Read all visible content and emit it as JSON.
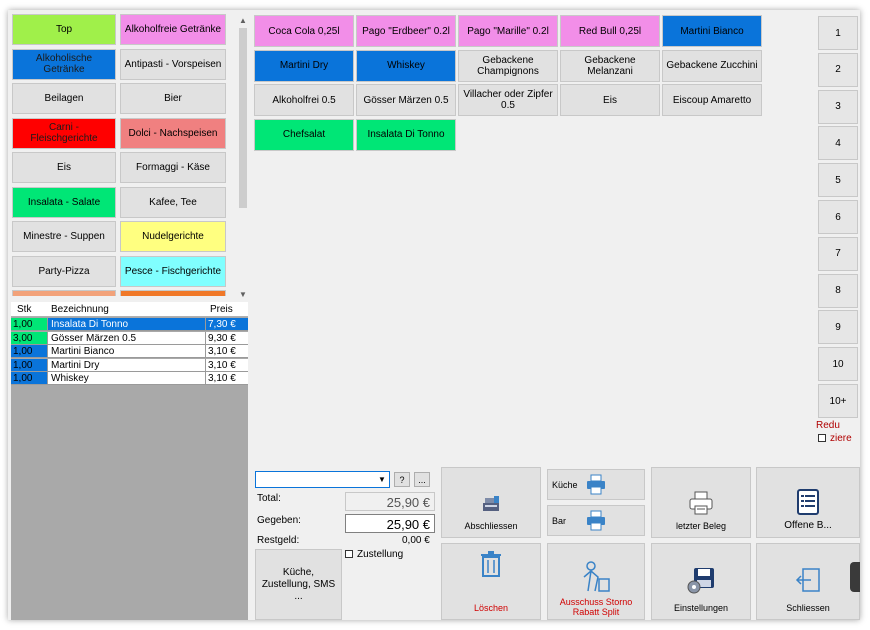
{
  "categories": [
    {
      "label": "Top",
      "color": "#a0f04a"
    },
    {
      "label": "Alkoholfreie Getränke",
      "color": "#f28ee8"
    },
    {
      "label": "Alkoholische Getränke",
      "color": "#0a74da"
    },
    {
      "label": "Antipasti - Vorspeisen",
      "color": "#e1e1e1"
    },
    {
      "label": "Beilagen",
      "color": "#e1e1e1"
    },
    {
      "label": "Bier",
      "color": "#e1e1e1"
    },
    {
      "label": "Carni - Fleischgerichte",
      "color": "#ff0000"
    },
    {
      "label": "Dolci - Nachspeisen",
      "color": "#f08080"
    },
    {
      "label": "Eis",
      "color": "#e1e1e1"
    },
    {
      "label": "Formaggi - Käse",
      "color": "#e1e1e1"
    },
    {
      "label": "Insalata - Salate",
      "color": "#00e676"
    },
    {
      "label": "Kafee, Tee",
      "color": "#e1e1e1"
    },
    {
      "label": "Minestre - Suppen",
      "color": "#e1e1e1"
    },
    {
      "label": "Nudelgerichte",
      "color": "#ffff80"
    },
    {
      "label": "Party-Pizza",
      "color": "#e1e1e1"
    },
    {
      "label": "Pesce - Fischgerichte",
      "color": "#80ffff"
    }
  ],
  "products": [
    {
      "label": "Coca Cola 0,25l",
      "color": "#f28ee8"
    },
    {
      "label": "Pago \"Erdbeer\" 0.2l",
      "color": "#f28ee8"
    },
    {
      "label": "Pago \"Marille\" 0.2l",
      "color": "#f28ee8"
    },
    {
      "label": "Red Bull 0,25l",
      "color": "#f28ee8"
    },
    {
      "label": "Martini Bianco",
      "color": "#0a74da"
    },
    {
      "label": "Martini Dry",
      "color": "#0a74da"
    },
    {
      "label": "Whiskey",
      "color": "#0a74da"
    },
    {
      "label": "Gebackene Champignons",
      "color": "#e1e1e1"
    },
    {
      "label": "Gebackene Melanzani",
      "color": "#e1e1e1"
    },
    {
      "label": "Gebackene Zucchini",
      "color": "#e1e1e1"
    },
    {
      "label": "Alkoholfrei 0.5",
      "color": "#e1e1e1"
    },
    {
      "label": "Gösser Märzen  0.5",
      "color": "#e1e1e1"
    },
    {
      "label": "Villacher oder Zipfer 0.5",
      "color": "#e1e1e1"
    },
    {
      "label": "Eis",
      "color": "#e1e1e1"
    },
    {
      "label": "Eiscoup Amaretto",
      "color": "#e1e1e1"
    },
    {
      "label": "Chefsalat",
      "color": "#00e676"
    },
    {
      "label": "Insalata Di Tonno",
      "color": "#00e676"
    }
  ],
  "order": {
    "headers": {
      "qty": "Stk",
      "name": "Bezeichnung",
      "price": "Preis"
    },
    "rows": [
      {
        "qty": "1,00",
        "name": "Insalata Di Tonno",
        "price": "7,30 €",
        "color": "#00e676",
        "selected": true
      },
      {
        "qty": "3,00",
        "name": "Gösser Märzen  0.5",
        "price": "9,30 €",
        "color": "#00e676",
        "selected": false
      },
      {
        "qty": "1,00",
        "name": "Martini Bianco",
        "price": "3,10 €",
        "color": "#0a74da",
        "selected": false
      },
      {
        "qty": "1,00",
        "name": "Martini Dry",
        "price": "3,10 €",
        "color": "#0a74da",
        "selected": false
      },
      {
        "qty": "1,00",
        "name": "Whiskey",
        "price": "3,10 €",
        "color": "#0a74da",
        "selected": false
      }
    ]
  },
  "tables": [
    "1",
    "2",
    "3",
    "4",
    "5",
    "6",
    "7",
    "8",
    "9",
    "10",
    "10+"
  ],
  "reduzieren": {
    "line1": "Redu",
    "line2": "ziere"
  },
  "payment": {
    "combo_value": "",
    "help_label": "?",
    "more_label": "...",
    "total_label": "Total:",
    "total_value": "25,90 €",
    "given_label": "Gegeben:",
    "given_value": "25,90 €",
    "change_label": "Restgeld:",
    "change_value": "0,00 €",
    "delivery_label": "Zustellung",
    "kitchen_sms_label": "Küche, Zustellung, SMS ..."
  },
  "actions": {
    "abschliessen": "Abschliessen",
    "kueche": "Küche",
    "bar": "Bar",
    "letzter_beleg": "letzter Beleg",
    "offene": "Offene B...",
    "loeschen": "Löschen",
    "ausschuss": "Ausschuss Storno Rabatt Split",
    "einstellungen": "Einstellungen",
    "schliessen": "Schliessen"
  },
  "colors": {
    "danger_text": "#d00000",
    "accent": "#0a74da"
  }
}
